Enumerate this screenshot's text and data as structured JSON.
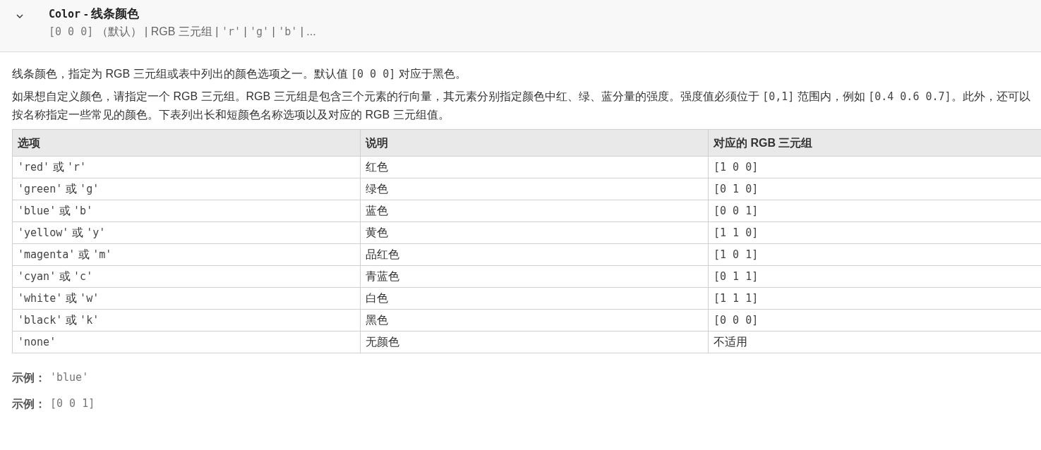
{
  "header": {
    "expanded": true,
    "name": "Color",
    "separator": " - ",
    "title": "线条颜色",
    "summary": [
      {
        "kind": "code",
        "text": "[0 0 0]"
      },
      {
        "kind": "text",
        "text": " （默认） | RGB 三元组 | "
      },
      {
        "kind": "code",
        "text": "'r'"
      },
      {
        "kind": "text",
        "text": " | "
      },
      {
        "kind": "code",
        "text": "'g'"
      },
      {
        "kind": "text",
        "text": " | "
      },
      {
        "kind": "code",
        "text": "'b'"
      },
      {
        "kind": "text",
        "text": " | ..."
      }
    ]
  },
  "paragraphs": [
    [
      {
        "kind": "text",
        "text": "线条颜色，指定为 RGB 三元组或表中列出的颜色选项之一。默认值 "
      },
      {
        "kind": "code",
        "text": "[0 0 0]"
      },
      {
        "kind": "text",
        "text": " 对应于黑色。"
      }
    ],
    [
      {
        "kind": "text",
        "text": "如果想自定义颜色，请指定一个 RGB 三元组。RGB 三元组是包含三个元素的行向量，其元素分别指定颜色中红、绿、蓝分量的强度。强度值必须位于 "
      },
      {
        "kind": "code",
        "text": "[0,1]"
      },
      {
        "kind": "text",
        "text": " 范围内，例如 "
      },
      {
        "kind": "code",
        "text": "[0.4 0.6 0.7]"
      },
      {
        "kind": "text",
        "text": "。此外，还可以按名称指定一些常见的颜色。下表列出长和短颜色名称选项以及对应的 RGB 三元组值。"
      }
    ]
  ],
  "table": {
    "columns": [
      "选项",
      "说明",
      "对应的 RGB 三元组"
    ],
    "rows": [
      [
        [
          {
            "kind": "code",
            "text": "'red'"
          },
          {
            "kind": "text",
            "text": " 或 "
          },
          {
            "kind": "code",
            "text": "'r'"
          }
        ],
        [
          {
            "kind": "text",
            "text": "红色"
          }
        ],
        [
          {
            "kind": "code",
            "text": "[1 0 0]"
          }
        ]
      ],
      [
        [
          {
            "kind": "code",
            "text": "'green'"
          },
          {
            "kind": "text",
            "text": " 或 "
          },
          {
            "kind": "code",
            "text": "'g'"
          }
        ],
        [
          {
            "kind": "text",
            "text": "绿色"
          }
        ],
        [
          {
            "kind": "code",
            "text": "[0 1 0]"
          }
        ]
      ],
      [
        [
          {
            "kind": "code",
            "text": "'blue'"
          },
          {
            "kind": "text",
            "text": " 或 "
          },
          {
            "kind": "code",
            "text": "'b'"
          }
        ],
        [
          {
            "kind": "text",
            "text": "蓝色"
          }
        ],
        [
          {
            "kind": "code",
            "text": "[0 0 1]"
          }
        ]
      ],
      [
        [
          {
            "kind": "code",
            "text": "'yellow'"
          },
          {
            "kind": "text",
            "text": " 或 "
          },
          {
            "kind": "code",
            "text": "'y'"
          }
        ],
        [
          {
            "kind": "text",
            "text": "黄色"
          }
        ],
        [
          {
            "kind": "code",
            "text": "[1 1 0]"
          }
        ]
      ],
      [
        [
          {
            "kind": "code",
            "text": "'magenta'"
          },
          {
            "kind": "text",
            "text": " 或 "
          },
          {
            "kind": "code",
            "text": "'m'"
          }
        ],
        [
          {
            "kind": "text",
            "text": "品红色"
          }
        ],
        [
          {
            "kind": "code",
            "text": "[1 0 1]"
          }
        ]
      ],
      [
        [
          {
            "kind": "code",
            "text": "'cyan'"
          },
          {
            "kind": "text",
            "text": " 或 "
          },
          {
            "kind": "code",
            "text": "'c'"
          }
        ],
        [
          {
            "kind": "text",
            "text": "青蓝色"
          }
        ],
        [
          {
            "kind": "code",
            "text": "[0 1 1]"
          }
        ]
      ],
      [
        [
          {
            "kind": "code",
            "text": "'white'"
          },
          {
            "kind": "text",
            "text": " 或 "
          },
          {
            "kind": "code",
            "text": "'w'"
          }
        ],
        [
          {
            "kind": "text",
            "text": "白色"
          }
        ],
        [
          {
            "kind": "code",
            "text": "[1 1 1]"
          }
        ]
      ],
      [
        [
          {
            "kind": "code",
            "text": "'black'"
          },
          {
            "kind": "text",
            "text": " 或 "
          },
          {
            "kind": "code",
            "text": "'k'"
          }
        ],
        [
          {
            "kind": "text",
            "text": "黑色"
          }
        ],
        [
          {
            "kind": "code",
            "text": "[0 0 0]"
          }
        ]
      ],
      [
        [
          {
            "kind": "code",
            "text": "'none'"
          }
        ],
        [
          {
            "kind": "text",
            "text": "无颜色"
          }
        ],
        [
          {
            "kind": "text",
            "text": "不适用"
          }
        ]
      ]
    ]
  },
  "examples": [
    {
      "label": "示例：",
      "value": "'blue'"
    },
    {
      "label": "示例：",
      "value": "[0 0 1]"
    }
  ]
}
